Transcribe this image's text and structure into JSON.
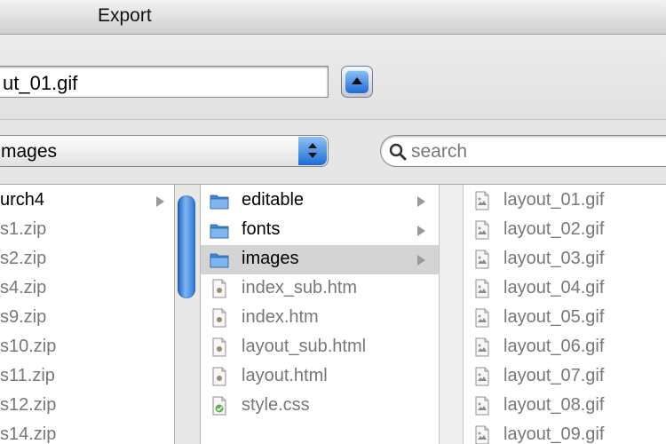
{
  "window": {
    "title": "Export"
  },
  "save_as": {
    "value": "ut_01.gif"
  },
  "location": {
    "selected": "mages"
  },
  "search": {
    "placeholder": "search"
  },
  "columns": {
    "col1": [
      "urch4",
      "s1.zip",
      "s2.zip",
      "s4.zip",
      "s9.zip",
      "s10.zip",
      "s11.zip",
      "s12.zip",
      "s14.zip"
    ],
    "col2": [
      {
        "name": "editable",
        "kind": "folder"
      },
      {
        "name": "fonts",
        "kind": "folder"
      },
      {
        "name": "images",
        "kind": "folder",
        "selected": true
      },
      {
        "name": "index_sub.htm",
        "kind": "file"
      },
      {
        "name": "index.htm",
        "kind": "file"
      },
      {
        "name": "layout_sub.html",
        "kind": "file"
      },
      {
        "name": "layout.html",
        "kind": "file"
      },
      {
        "name": "style.css",
        "kind": "css"
      }
    ],
    "col3": [
      "layout_01.gif",
      "layout_02.gif",
      "layout_03.gif",
      "layout_04.gif",
      "layout_05.gif",
      "layout_06.gif",
      "layout_07.gif",
      "layout_08.gif",
      "layout_09.gif"
    ]
  },
  "colors": {
    "accent": "#2d74d6",
    "folder": "#5aa0e8",
    "selection": "#d4d4d4"
  }
}
